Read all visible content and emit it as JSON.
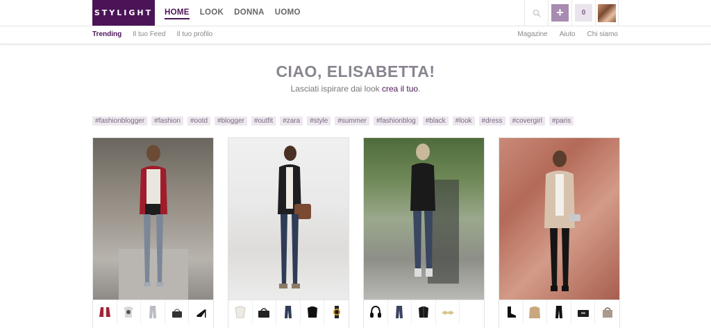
{
  "header": {
    "logo": "STYLIGHT",
    "nav": [
      {
        "label": "HOME",
        "active": true
      },
      {
        "label": "LOOK",
        "active": false
      },
      {
        "label": "DONNA",
        "active": false
      },
      {
        "label": "UOMO",
        "active": false
      }
    ],
    "search_icon": "search-icon",
    "add_label": "+",
    "count": "0"
  },
  "subnav": {
    "left": [
      {
        "label": "Trending",
        "active": true
      },
      {
        "label": "Il tuo Feed",
        "active": false
      },
      {
        "label": "Il tuo profilo",
        "active": false
      }
    ],
    "right": [
      "Magazine",
      "Aiuto",
      "Chi siamo"
    ]
  },
  "hero": {
    "greeting": "CIAO, ELISABETTA!",
    "tagline_prefix": "Lasciati ispirare dai look ",
    "tagline_link": "crea il tuo",
    "tagline_suffix": "."
  },
  "tags": [
    "#fashionblogger",
    "#fashion",
    "#ootd",
    "#blogger",
    "#outfit",
    "#zara",
    "#style",
    "#summer",
    "#fashionblog",
    "#black",
    "#look",
    "#dress",
    "#covergirl",
    "#paris"
  ],
  "looks": [
    {
      "items": [
        "varsity-jacket",
        "graphic-tee",
        "jeans",
        "shoulder-bag",
        "heels"
      ]
    },
    {
      "items": [
        "blouse",
        "handbag",
        "jeans",
        "blazer",
        "watch"
      ]
    },
    {
      "items": [
        "headphones",
        "jeans",
        "leather-jacket",
        "sunglasses",
        ""
      ]
    },
    {
      "items": [
        "ankle-boots",
        "trench-coat",
        "leather-pants",
        "clutch",
        "tote-bag"
      ]
    }
  ],
  "colors": {
    "brand": "#4b1457",
    "accent": "#a78bb0",
    "tag_bg": "#ede8ef"
  }
}
